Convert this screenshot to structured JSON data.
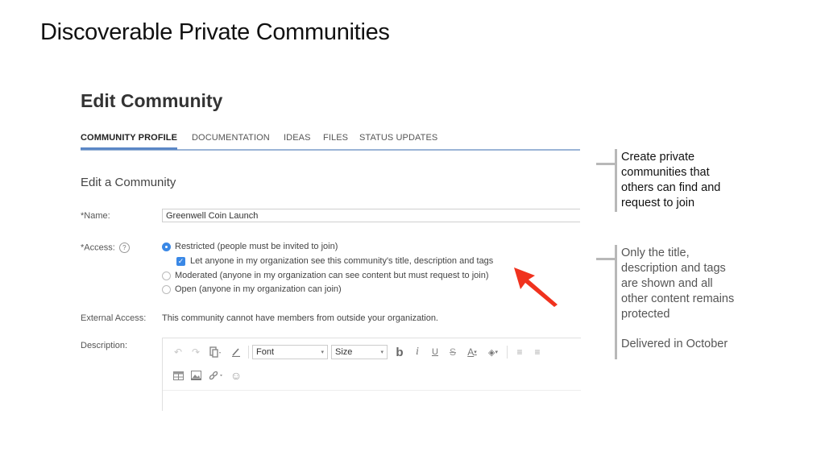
{
  "slide": {
    "title": "Discoverable Private Communities"
  },
  "page": {
    "title": "Edit Community",
    "tabs": [
      {
        "label": "COMMUNITY PROFILE",
        "active": true
      },
      {
        "label": "DOCUMENTATION",
        "active": false
      },
      {
        "label": "IDEAS",
        "active": false
      },
      {
        "label": "FILES",
        "active": false
      },
      {
        "label": "STATUS UPDATES",
        "active": false
      }
    ],
    "section_title": "Edit a Community"
  },
  "form": {
    "name_label": "*Name:",
    "name_value": "Greenwell Coin Launch",
    "access_label": "*Access:",
    "help_icon": "?",
    "access_options": [
      {
        "label": "Restricted (people must be invited to join)",
        "selected": true
      },
      {
        "label": "Moderated (anyone in my organization can see content but must request to join)",
        "selected": false
      },
      {
        "label": "Open (anyone in my organization can join)",
        "selected": false
      }
    ],
    "discoverable_checkbox": {
      "label": "Let anyone in my organization see this community's title, description and tags",
      "checked": true
    },
    "external_access_label": "External Access:",
    "external_access_value": "This community cannot have members from outside your organization.",
    "description_label": "Description:"
  },
  "editor_toolbar": {
    "undo_icon": "↶",
    "redo_icon": "↷",
    "paste_icon": "📋",
    "format_painter_icon": "✎",
    "font_select": "Font",
    "size_select": "Size",
    "bold": "b",
    "italic": "i",
    "underline": "U",
    "strikethrough": "S",
    "font_color": "A",
    "highlight": "◈",
    "align_left": "≡",
    "align_center": "≡",
    "table_icon": "▦",
    "image_icon": "▣",
    "link_icon": "🔗",
    "emoji_icon": "☺",
    "dropdown_caret": "▾"
  },
  "callouts": [
    {
      "text": "Create private communities that others can find and request to join"
    },
    {
      "text": "Only the title, description and tags are shown and all other content remains protected",
      "note": "Delivered in October"
    }
  ],
  "colors": {
    "accent_blue": "#3a88e6",
    "tab_underline": "#5b87c6",
    "arrow_red": "#f0321e",
    "delivered_blue": "#3b78c4"
  }
}
